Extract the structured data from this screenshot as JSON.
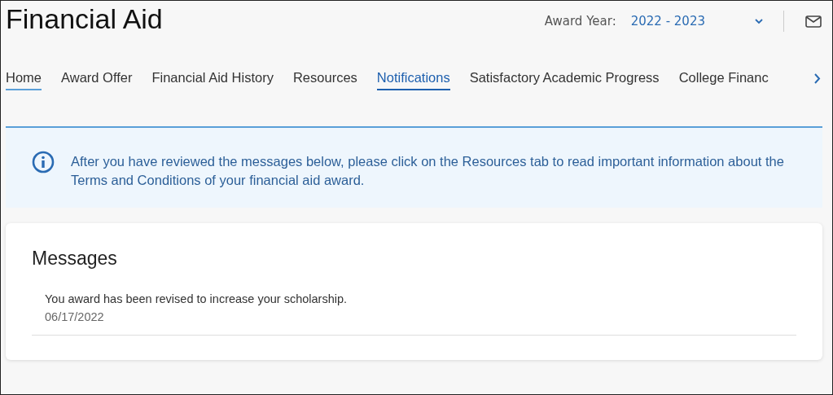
{
  "header": {
    "title": "Financial Aid",
    "award_year_label": "Award Year:",
    "award_year_value": "2022 - 2023"
  },
  "tabs": [
    {
      "label": "Home",
      "selected": false,
      "hover": true
    },
    {
      "label": "Award Offer",
      "selected": false,
      "hover": false
    },
    {
      "label": "Financial Aid History",
      "selected": false,
      "hover": false
    },
    {
      "label": "Resources",
      "selected": false,
      "hover": false
    },
    {
      "label": "Notifications",
      "selected": true,
      "hover": false
    },
    {
      "label": "Satisfactory Academic Progress",
      "selected": false,
      "hover": false
    },
    {
      "label": "College Financ",
      "selected": false,
      "hover": false
    }
  ],
  "info_banner": {
    "text": "After you have reviewed the messages below, please click on the Resources tab to read important information about the Terms and Conditions of your financial aid award."
  },
  "messages": {
    "title": "Messages",
    "items": [
      {
        "text": "You award has been revised to increase your scholarship.",
        "date": "06/17/2022"
      }
    ]
  }
}
